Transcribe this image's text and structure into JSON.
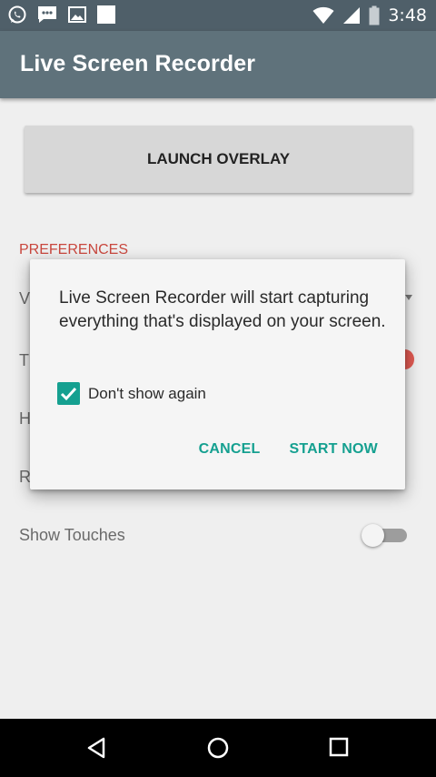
{
  "status_bar": {
    "time": "3:48",
    "left_icons": [
      "whatsapp-icon",
      "message-icon",
      "gallery-icon",
      "blank-notification-icon"
    ],
    "right_icons": [
      "wifi-icon",
      "signal-icon",
      "battery-icon"
    ]
  },
  "app_bar": {
    "title": "Live Screen Recorder"
  },
  "content": {
    "launch_button": "LAUNCH OVERLAY",
    "preferences_header": "PREFERENCES",
    "rows": [
      {
        "label_partial": "V"
      },
      {
        "label_partial": "T"
      },
      {
        "label_partial": "H"
      },
      {
        "label_partial": "R"
      }
    ],
    "show_touches_label": "Show Touches",
    "show_touches_enabled": false
  },
  "dialog": {
    "message": "Live Screen Recorder will start capturing everything that's displayed on your screen.",
    "checkbox_label": "Don't show again",
    "checkbox_checked": true,
    "cancel": "CANCEL",
    "start_now": "START NOW"
  },
  "nav_bar": {
    "icons": [
      "back-icon",
      "home-icon",
      "recents-icon"
    ]
  },
  "colors": {
    "accent": "#15a090",
    "preferences_header": "#c9473e",
    "app_bar": "#5f727b",
    "status_bar": "#4f5f69"
  }
}
